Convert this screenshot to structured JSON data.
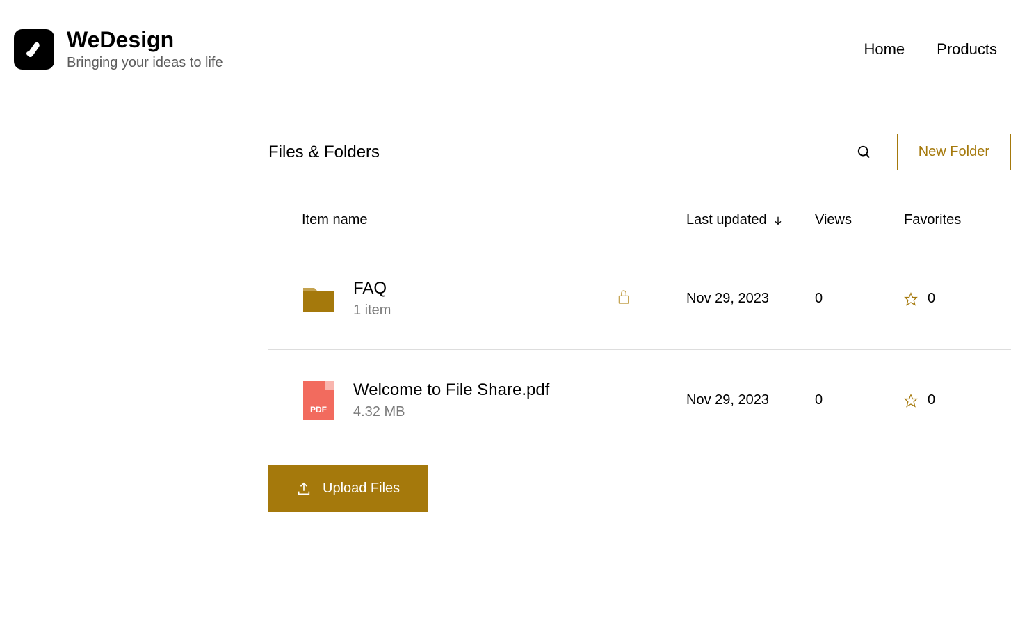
{
  "brand": {
    "title": "WeDesign",
    "tagline": "Bringing your ideas to life"
  },
  "nav": {
    "home": "Home",
    "products": "Products"
  },
  "page": {
    "title": "Files & Folders",
    "new_folder_label": "New Folder",
    "upload_label": "Upload Files"
  },
  "table": {
    "headers": {
      "item_name": "Item name",
      "last_updated": "Last updated",
      "views": "Views",
      "favorites": "Favorites"
    },
    "rows": [
      {
        "name": "FAQ",
        "subtitle": "1 item",
        "type": "folder",
        "locked": true,
        "last_updated": "Nov 29, 2023",
        "views": "0",
        "favorites": "0"
      },
      {
        "name": "Welcome to File Share.pdf",
        "subtitle": "4.32 MB",
        "type": "pdf",
        "locked": false,
        "last_updated": "Nov 29, 2023",
        "views": "0",
        "favorites": "0"
      }
    ]
  }
}
